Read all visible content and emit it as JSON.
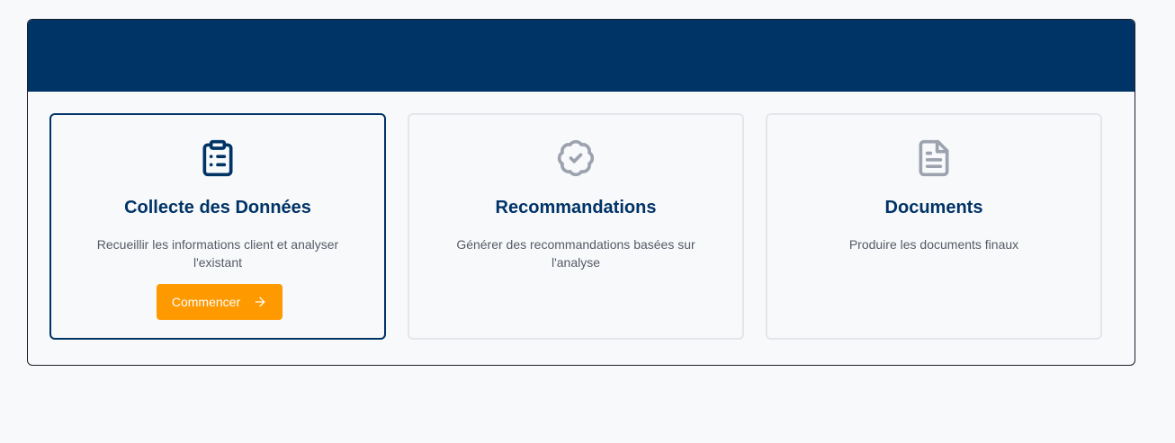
{
  "colors": {
    "header": "#003366",
    "accent": "#ff9900",
    "active_icon": "#003366",
    "inactive_icon": "#9ca3af"
  },
  "steps": [
    {
      "icon": "clipboard-list-icon",
      "title": "Collecte des Données",
      "description": "Recueillir les informations client et analyser l'existant",
      "button_label": "Commencer",
      "active": true
    },
    {
      "icon": "badge-check-icon",
      "title": "Recommandations",
      "description": "Générer des recommandations basées sur l'analyse",
      "active": false
    },
    {
      "icon": "file-text-icon",
      "title": "Documents",
      "description": "Produire les documents finaux",
      "active": false
    }
  ]
}
